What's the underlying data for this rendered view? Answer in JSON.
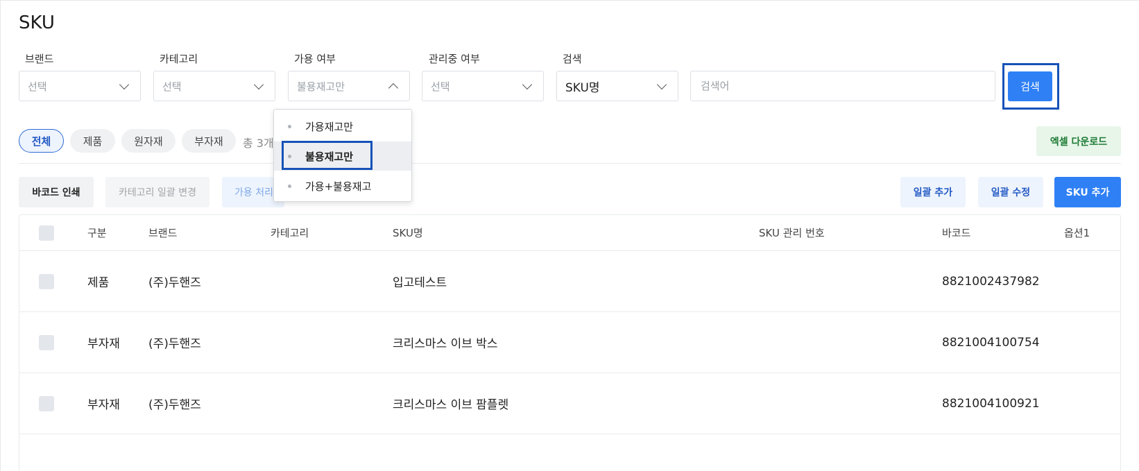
{
  "page": {
    "title": "SKU"
  },
  "filters": {
    "brand": {
      "label": "브랜드",
      "value": "선택"
    },
    "category": {
      "label": "카테고리",
      "value": "선택"
    },
    "availability": {
      "label": "가용 여부",
      "value": "불용재고만"
    },
    "managed": {
      "label": "관리중 여부",
      "value": "선택"
    },
    "search": {
      "label": "검색",
      "type_value": "SKU명",
      "placeholder": "검색어",
      "button_label": "검색"
    }
  },
  "availability_dropdown": {
    "options": [
      "가용재고만",
      "불용재고만",
      "가용+불용재고"
    ],
    "selected": "불용재고만"
  },
  "type_chips": {
    "items": [
      "전체",
      "제품",
      "원자재",
      "부자재"
    ],
    "active": "전체",
    "total_text": "총 3개"
  },
  "excel_download_label": "엑셀 다운로드",
  "actions": {
    "barcode_print": "바코드 인쇄",
    "category_bulk_change": "카테고리 일괄 변경",
    "availability_process": "가용 처리",
    "bulk_add": "일괄 추가",
    "bulk_edit": "일괄 수정",
    "sku_add": "SKU 추가"
  },
  "table": {
    "headers": [
      "구분",
      "브랜드",
      "카테고리",
      "SKU명",
      "SKU 관리 번호",
      "바코드",
      "옵션1"
    ],
    "rows": [
      {
        "type": "제품",
        "brand": "(주)두핸즈",
        "category": "",
        "sku_name": "입고테스트",
        "sku_code": "",
        "barcode": "8821002437982",
        "option1": ""
      },
      {
        "type": "부자재",
        "brand": "(주)두핸즈",
        "category": "",
        "sku_name": "크리스마스 이브 박스",
        "sku_code": "",
        "barcode": "8821004100754",
        "option1": ""
      },
      {
        "type": "부자재",
        "brand": "(주)두핸즈",
        "category": "",
        "sku_name": "크리스마스 이브 팜플렛",
        "sku_code": "",
        "barcode": "8821004100921",
        "option1": ""
      }
    ]
  },
  "colors": {
    "primary": "#2f80f5",
    "highlight_border": "#1652b8",
    "excel_bg": "#e8f6ea",
    "excel_text": "#1d7a33"
  }
}
